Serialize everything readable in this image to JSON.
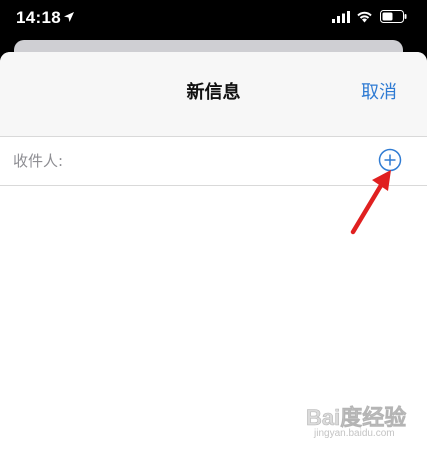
{
  "status_bar": {
    "time": "14:18",
    "icons": [
      "location-arrow-icon",
      "cellular-signal-icon",
      "wifi-icon",
      "battery-icon"
    ]
  },
  "nav": {
    "title": "新信息",
    "cancel_label": "取消"
  },
  "recipient": {
    "label": "收件人:",
    "value": ""
  },
  "watermark": {
    "logo": "Bai度经验",
    "url": "jingyan.baidu.com"
  },
  "colors": {
    "accent": "#2f7bd3",
    "annotation_arrow": "#e02020",
    "nav_background": "#f7f7f7"
  }
}
